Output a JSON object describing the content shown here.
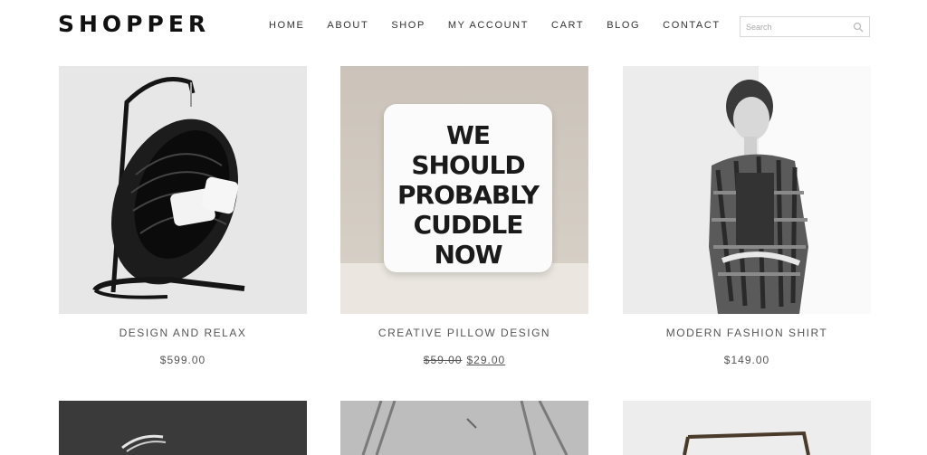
{
  "header": {
    "logo": "SHOPPER",
    "nav": [
      "HOME",
      "ABOUT",
      "SHOP",
      "MY ACCOUNT",
      "CART",
      "BLOG",
      "CONTACT"
    ],
    "search": {
      "placeholder": "Search",
      "value": ""
    }
  },
  "products": [
    {
      "name": "DESIGN AND RELAX",
      "price": "$599.00",
      "image": "hanging-egg-chair"
    },
    {
      "name": "CREATIVE PILLOW DESIGN",
      "old_price": "$59.00",
      "price": "$29.00",
      "image": "pillow",
      "pillow_text": [
        "WE",
        "SHOULD",
        "PROBABLY",
        "CUDDLE",
        "NOW"
      ]
    },
    {
      "name": "MODERN FASHION SHIRT",
      "price": "$149.00",
      "image": "fashion-model"
    }
  ],
  "row2_images": [
    "wicker-chair",
    "wire-chair",
    "frame-table"
  ]
}
